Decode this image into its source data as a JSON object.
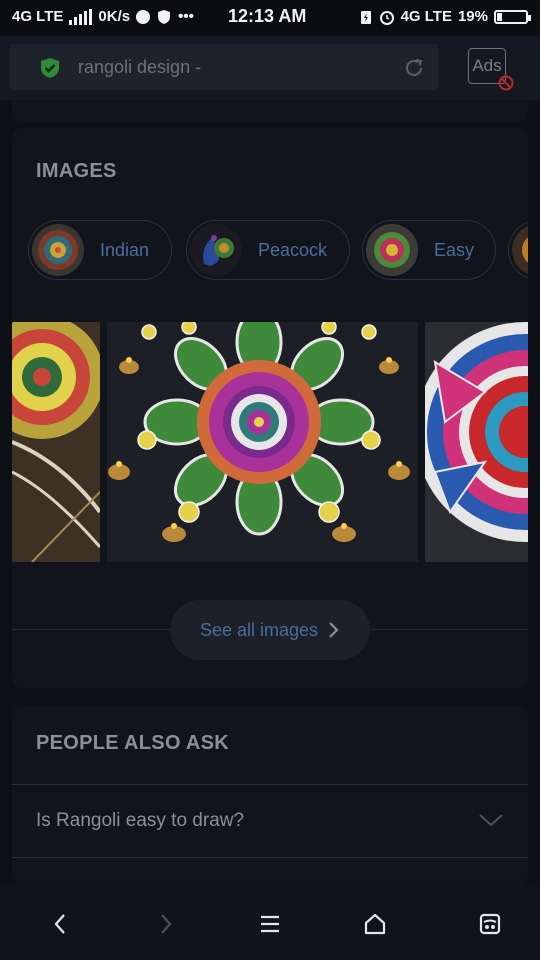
{
  "status_bar": {
    "network_left": "4G LTE",
    "speed": "0K/s",
    "time": "12:13 AM",
    "network_right": "4G LTE",
    "battery": "19%",
    "battery_level": 0.19
  },
  "browser": {
    "url_text": "rangoli design -",
    "ads_label": "Ads"
  },
  "images_section": {
    "title": "IMAGES",
    "chips": [
      {
        "label": "Indian"
      },
      {
        "label": "Peacock"
      },
      {
        "label": "Easy"
      }
    ],
    "see_all_label": "See all images"
  },
  "people_also_ask": {
    "title": "PEOPLE ALSO ASK",
    "questions": [
      {
        "text": "Is Rangoli easy to draw?"
      }
    ]
  },
  "icons": {
    "shield": "shield-check-icon",
    "reload": "reload-icon",
    "back": "chevron-left-icon",
    "forward": "chevron-right-icon",
    "menu": "menu-icon",
    "home": "home-icon",
    "tabs": "tabs-icon"
  },
  "colors": {
    "accent_link": "#4a6e9a",
    "shield_green": "#2f8a3a",
    "background": "#0d1016"
  }
}
